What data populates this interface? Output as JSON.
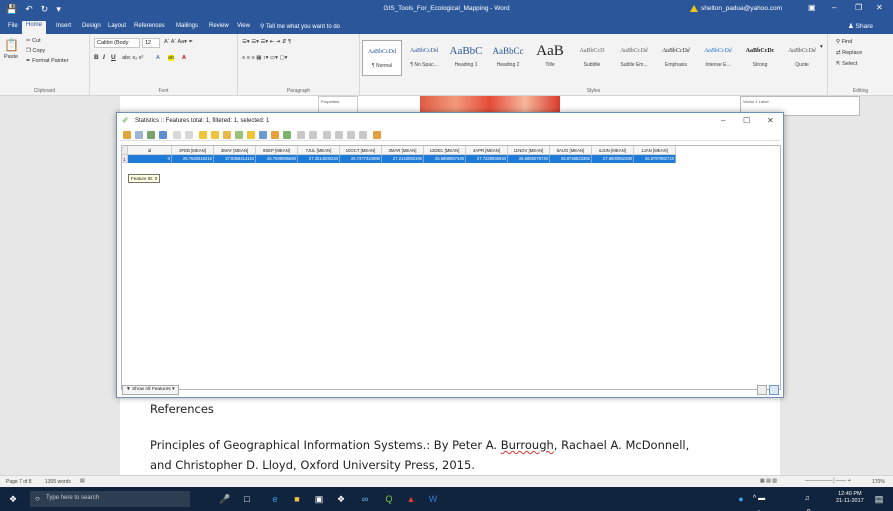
{
  "word": {
    "doc_title": "GIS_Tools_For_Ecological_Mapping - Word",
    "user_email": "shelton_padua@yahoo.com",
    "share_label": "Share",
    "tabs": [
      "File",
      "Home",
      "Insert",
      "Design",
      "Layout",
      "References",
      "Mailings",
      "Review",
      "View"
    ],
    "tell_me": "Tell me what you want to do",
    "clipboard": {
      "cut": "Cut",
      "copy": "Copy",
      "paste": "Paste",
      "format_painter": "Format Painter",
      "label": "Clipboard"
    },
    "font": {
      "name": "Calibri (Body",
      "size": "12",
      "label": "Font"
    },
    "paragraph": {
      "label": "Paragraph"
    },
    "styles": {
      "label": "Styles",
      "items": [
        {
          "preview": "AaBbCcDd",
          "name": "¶ Normal"
        },
        {
          "preview": "AaBbCcDd",
          "name": "¶ No Spac..."
        },
        {
          "preview": "AaBbC",
          "name": "Heading 1"
        },
        {
          "preview": "AaBbCc",
          "name": "Heading 2"
        },
        {
          "preview": "AaB",
          "name": "Title"
        },
        {
          "preview": "AaBbCcD",
          "name": "Subtitle"
        },
        {
          "preview": "AaBbCcDd",
          "name": "Subtle Em..."
        },
        {
          "preview": "AaBbCcDd",
          "name": "Emphasis"
        },
        {
          "preview": "AaBbCcDd",
          "name": "Intense E..."
        },
        {
          "preview": "AaBbCcDc",
          "name": "Strong"
        },
        {
          "preview": "AaBbCcDd",
          "name": "Quote"
        }
      ]
    },
    "editing": {
      "find": "Find",
      "replace": "Replace",
      "select": "Select",
      "label": "Editing"
    },
    "status": {
      "page": "Page 7 of 8",
      "words": "1305 words",
      "zoom": "170%"
    }
  },
  "document": {
    "properties_label": "Properties",
    "legend_text": "Vector 1 Label",
    "heading": "References",
    "ref_line1_pre": "Principles of Geographical Information Systems.: By Peter A. ",
    "ref_line1_name": "Burrough",
    "ref_line1_post": ", Rachael A. McDonnell,",
    "ref_line2": "and Christopher D. Lloyd, Oxford University Press, 2015."
  },
  "stats_dialog": {
    "title": "Statistics :: Features total: 1, filtered: 1, selected: 1",
    "columns": [
      "id",
      "2FEB [MEAN]",
      "3MAY [MEAN]",
      "9SEP [MEAN]",
      "7JUL [MEAN]",
      "10OCT [MEAN]",
      "3MAR [MEAN]",
      "12DEC [MEAN]",
      "4APR [MEAN]",
      "11NOV [MEAN]",
      "8AUG [MEAN]",
      "6JUN [MEAN]",
      "1JAN [MEAN]"
    ],
    "row_number": "1",
    "row": [
      "0",
      "26.7640616210",
      "27.8356414110",
      "26.7599085660",
      "27.2514500240",
      "26.7377324980",
      "27.2143083190",
      "26.5898957440",
      "27.7329935940",
      "26.6855075720",
      "26.8746823350",
      "27.6500852280",
      "26.5787982710"
    ],
    "tooltip": "Feature ID: 0",
    "show_all": "Show All Features"
  },
  "taskbar": {
    "search_placeholder": "Type here to search",
    "time": "12:40 PM",
    "date": "21-11-2017"
  }
}
